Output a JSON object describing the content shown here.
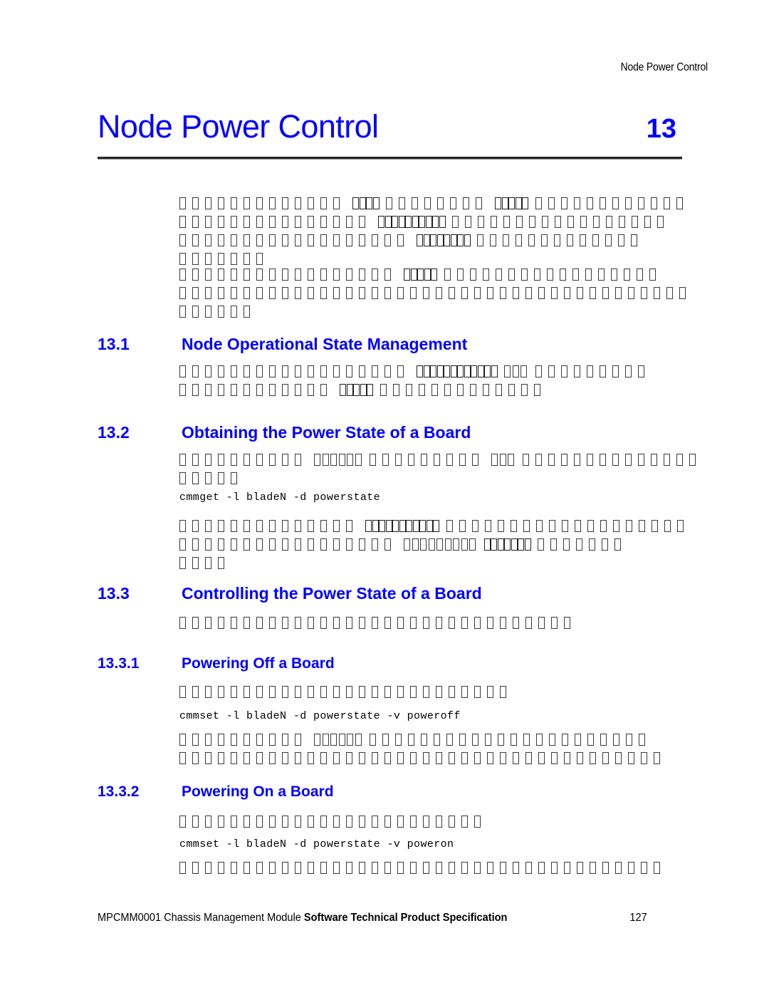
{
  "document": {
    "running_head": "Node Power Control",
    "chapter_title": "Node Power Control",
    "chapter_number": "13"
  },
  "sections": [
    {
      "number": "13.1",
      "title": "Node Operational State Management"
    },
    {
      "number": "13.2",
      "title": "Obtaining the Power State of a Board"
    },
    {
      "number": "13.3",
      "title": "Controlling the Power State of a Board"
    },
    {
      "number": "13.3.1",
      "title": "Powering Off a Board"
    },
    {
      "number": "13.3.2",
      "title": "Powering On a Board"
    }
  ],
  "code_lines": [
    {
      "id": "get-powerstate",
      "text": "cmmget -l bladeN -d powerstate"
    },
    {
      "id": "set-poweroff",
      "text": "cmmset -l bladeN -d powerstate -v poweroff"
    },
    {
      "id": "set-poweron",
      "text": "cmmset -l bladeN -d powerstate -v poweron"
    }
  ],
  "body_paragraphs": [
    {
      "id": "intro-para-1",
      "note": "body glyphs failed to render; shown as missing-glyph boxes",
      "lines": [
        [
          {
            "n": 13,
            "style": "normal"
          },
          {
            "n": 4,
            "style": "tight"
          },
          {
            "n": 8,
            "style": "normal"
          },
          {
            "n": 5,
            "style": "tight"
          },
          {
            "n": 12,
            "style": "normal"
          }
        ],
        [
          {
            "n": 15,
            "style": "normal"
          },
          {
            "n": 10,
            "style": "tight"
          },
          {
            "n": 17,
            "style": "normal"
          }
        ],
        [
          {
            "n": 18,
            "style": "normal"
          },
          {
            "n": 8,
            "style": "tight"
          },
          {
            "n": 13,
            "style": "normal"
          }
        ],
        [
          {
            "n": 7,
            "style": "normal"
          }
        ]
      ]
    },
    {
      "id": "intro-para-2",
      "lines": [
        [
          {
            "n": 17,
            "style": "normal"
          },
          {
            "n": 5,
            "style": "tight"
          },
          {
            "n": 17,
            "style": "normal"
          }
        ],
        [
          {
            "n": 40,
            "style": "normal"
          }
        ],
        [
          {
            "n": 6,
            "style": "normal"
          }
        ]
      ]
    },
    {
      "id": "sec-13-1-para",
      "lines": [
        [
          {
            "n": 18,
            "style": "normal"
          },
          {
            "n": 12,
            "style": "tight"
          },
          {
            "n": 3,
            "style": "semi"
          },
          {
            "n": 9,
            "style": "normal"
          }
        ],
        [
          {
            "n": 12,
            "style": "normal"
          },
          {
            "n": 5,
            "style": "tight"
          },
          {
            "n": 13,
            "style": "normal"
          }
        ]
      ]
    },
    {
      "id": "sec-13-2-para",
      "lines": [
        [
          {
            "n": 10,
            "style": "normal"
          },
          {
            "n": 6,
            "style": "semi"
          },
          {
            "n": 9,
            "style": "normal"
          },
          {
            "n": 3,
            "style": "semi"
          },
          {
            "n": 14,
            "style": "normal"
          }
        ],
        [
          {
            "n": 5,
            "style": "normal"
          }
        ]
      ]
    },
    {
      "id": "sec-13-2-after-code",
      "lines": [
        [
          {
            "n": 14,
            "style": "normal"
          },
          {
            "n": 11,
            "style": "tight"
          },
          {
            "n": 19,
            "style": "normal"
          }
        ],
        [
          {
            "n": 17,
            "style": "normal"
          },
          {
            "n": 9,
            "style": "semi"
          },
          {
            "n": 7,
            "style": "tight"
          },
          {
            "n": 7,
            "style": "normal"
          }
        ],
        [
          {
            "n": 4,
            "style": "normal"
          }
        ]
      ]
    },
    {
      "id": "sec-13-3-para",
      "lines": [
        [
          {
            "n": 31,
            "style": "normal"
          }
        ]
      ]
    },
    {
      "id": "sec-13-3-1-para",
      "lines": [
        [
          {
            "n": 26,
            "style": "normal"
          }
        ]
      ]
    },
    {
      "id": "sec-13-3-1-after-code",
      "lines": [
        [
          {
            "n": 10,
            "style": "normal"
          },
          {
            "n": 6,
            "style": "semi"
          },
          {
            "n": 22,
            "style": "normal"
          }
        ],
        [
          {
            "n": 38,
            "style": "normal"
          }
        ]
      ]
    },
    {
      "id": "sec-13-3-2-para",
      "lines": [
        [
          {
            "n": 24,
            "style": "normal"
          }
        ]
      ]
    },
    {
      "id": "sec-13-3-2-after-code",
      "lines": [
        [
          {
            "n": 38,
            "style": "normal"
          }
        ]
      ]
    }
  ],
  "footer": {
    "text_regular": "MPCMM0001 Chassis Management Module ",
    "text_bold": "Software Technical Product Specification",
    "page_number": "127"
  },
  "colors": {
    "heading_blue": "#0000ff",
    "body_text": "#000000",
    "rule": "#2a2a2a",
    "page_background": "#ffffff"
  }
}
